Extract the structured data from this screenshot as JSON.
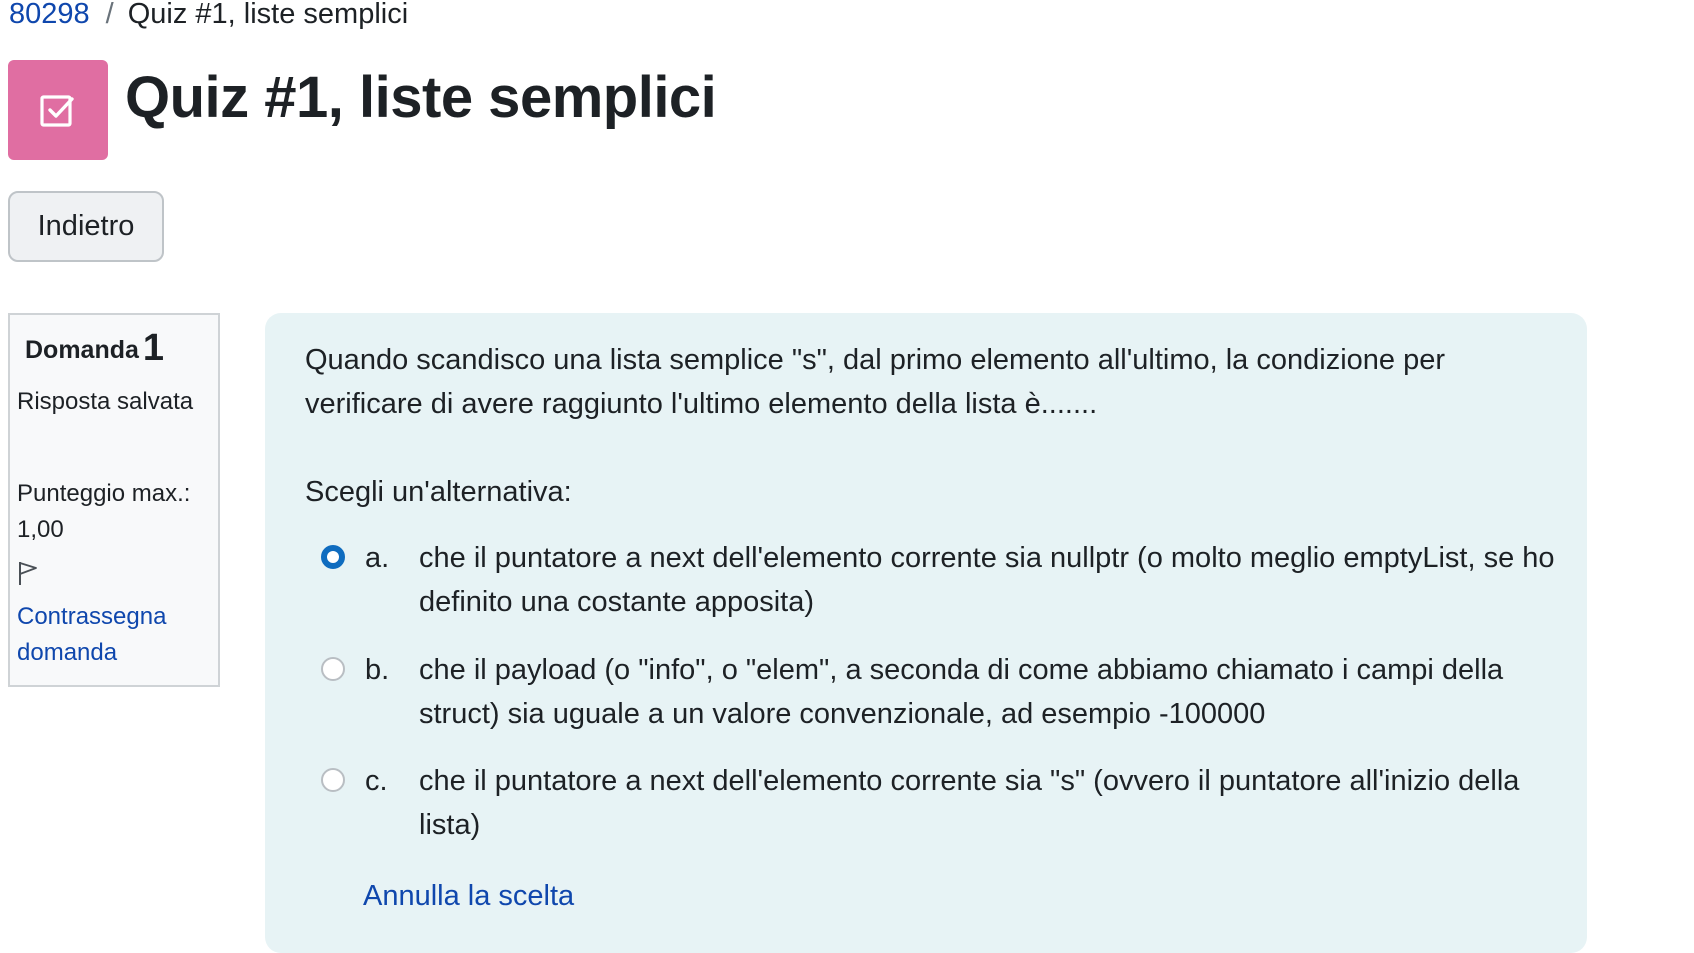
{
  "breadcrumb": {
    "course": "80298",
    "separator": "/",
    "current": "Quiz #1, liste semplici"
  },
  "page": {
    "title": "Quiz #1, liste semplici",
    "back_label": "Indietro"
  },
  "question_info": {
    "label": "Domanda",
    "number": "1",
    "status": "Risposta salvata",
    "max_score": "Punteggio max.: 1,00",
    "flag_label": "Contrassegna domanda"
  },
  "question": {
    "text": "Quando scandisco una lista semplice \"s\", dal primo elemento all'ultimo, la condizione per verificare di avere raggiunto l'ultimo elemento della lista è.......",
    "prompt": "Scegli un'alternativa:",
    "options": [
      {
        "letter": "a.",
        "text": "che il puntatore a next dell'elemento corrente sia nullptr (o molto meglio emptyList, se ho definito una costante apposita)",
        "selected": true
      },
      {
        "letter": "b.",
        "text": "che il payload (o \"info\", o \"elem\", a seconda di come abbiamo chiamato i campi della struct) sia uguale a un valore convenzionale, ad esempio -100000",
        "selected": false
      },
      {
        "letter": "c.",
        "text": "che il puntatore a next dell'elemento corrente sia \"s\" (ovvero il puntatore all'inizio della lista)",
        "selected": false
      }
    ],
    "clear_label": "Annulla la scelta"
  },
  "colors": {
    "link": "#0f47ad",
    "accent": "#0f6cbf",
    "quiz_icon_bg": "#e06ea2",
    "content_bg": "#e7f3f5"
  },
  "icons": {
    "activity": "quiz-checkbox-icon",
    "flag": "flag-icon"
  }
}
